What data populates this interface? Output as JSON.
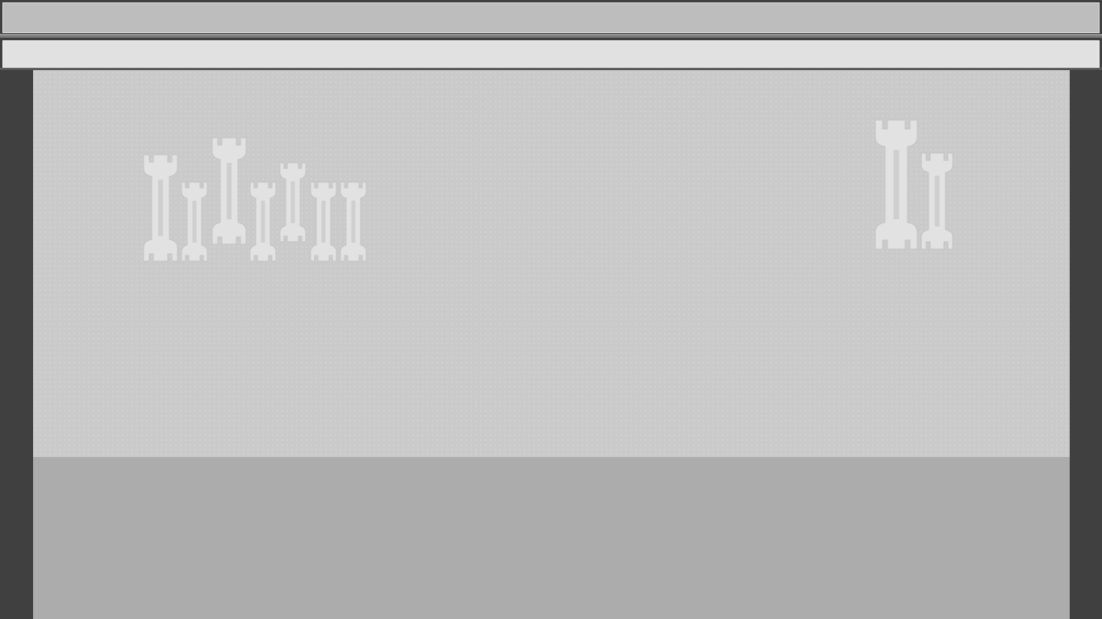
{
  "top_bar": {
    "title": ""
  },
  "second_bar": {
    "label": ""
  },
  "decoration": {
    "icon_name": "wrench-icon",
    "icon_color": "#e2e2e2",
    "left_group_count": 7,
    "right_group_count": 2
  },
  "colors": {
    "frame": "#404040",
    "top_bar": "#bdbdbd",
    "second_bar": "#e1e1e1",
    "main_panel": "#cacaca",
    "lower_panel": "#acacac"
  }
}
